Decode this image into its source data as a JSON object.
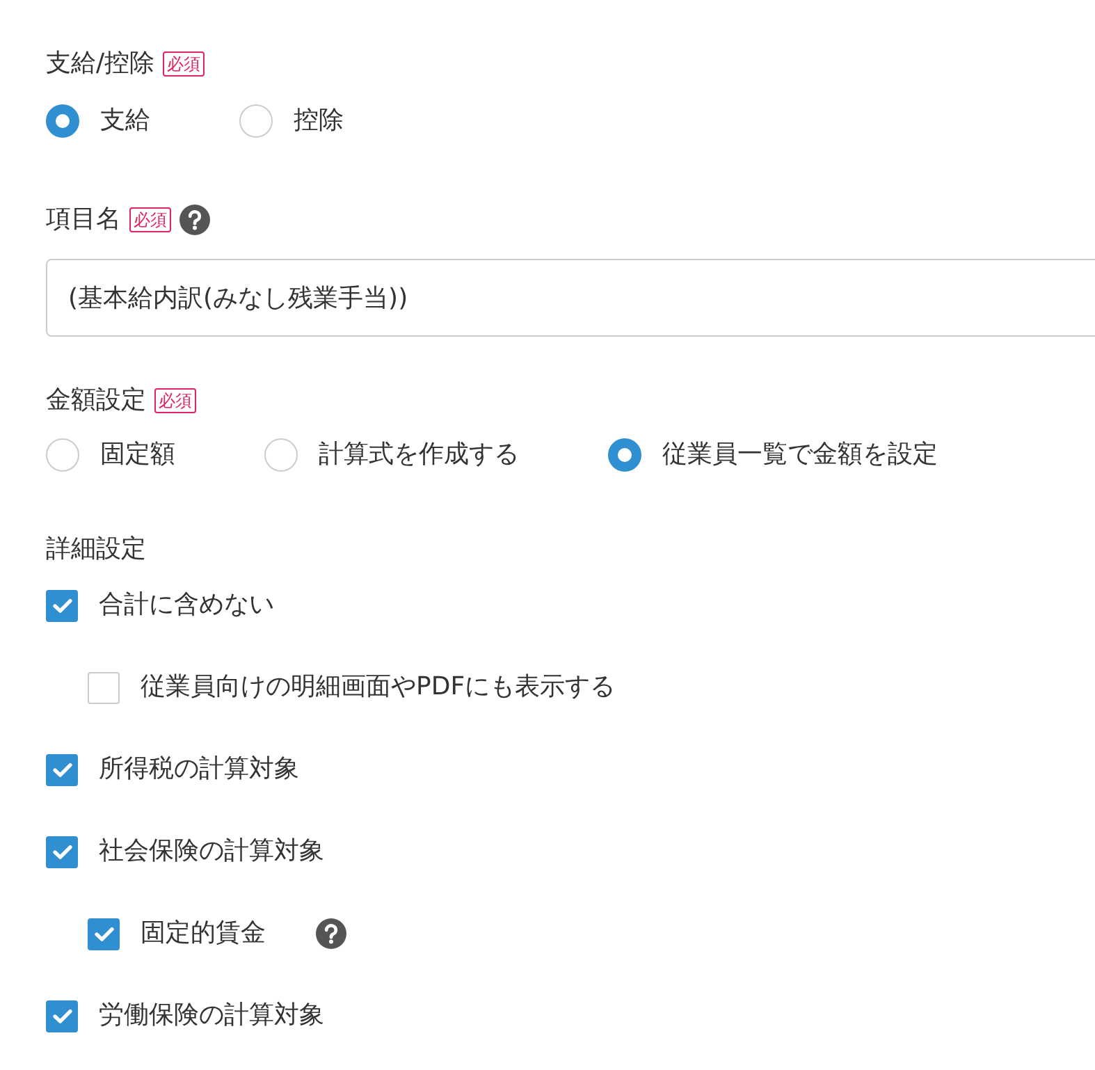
{
  "pay_type": {
    "label": "支給/控除",
    "required": "必須",
    "options": [
      {
        "label": "支給",
        "selected": true
      },
      {
        "label": "控除",
        "selected": false
      }
    ]
  },
  "item_name": {
    "label": "項目名",
    "required": "必須",
    "help": true,
    "value": "(基本給内訳(みなし残業手当))"
  },
  "amount_setting": {
    "label": "金額設定",
    "required": "必須",
    "options": [
      {
        "label": "固定額",
        "selected": false
      },
      {
        "label": "計算式を作成する",
        "selected": false
      },
      {
        "label": "従業員一覧で金額を設定",
        "selected": true
      }
    ]
  },
  "details": {
    "label": "詳細設定",
    "items": [
      {
        "label": "合計に含めない",
        "checked": true,
        "children": [
          {
            "label": "従業員向けの明細画面やPDFにも表示する",
            "checked": false
          }
        ]
      },
      {
        "label": "所得税の計算対象",
        "checked": true
      },
      {
        "label": "社会保険の計算対象",
        "checked": true,
        "children": [
          {
            "label": "固定的賃金",
            "checked": true,
            "help": true
          }
        ]
      },
      {
        "label": "労働保険の計算対象",
        "checked": true
      }
    ]
  }
}
